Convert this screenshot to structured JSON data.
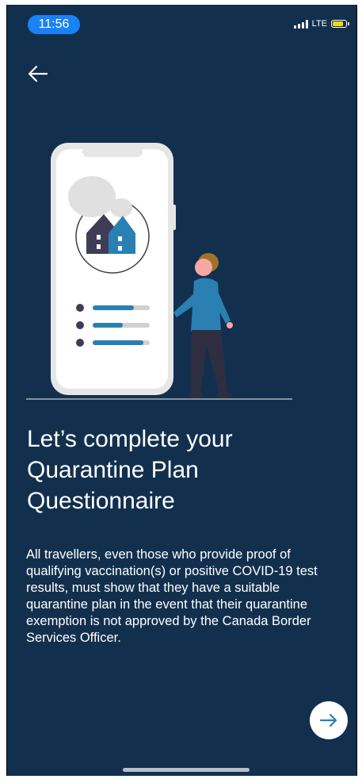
{
  "status_bar": {
    "time": "11:56",
    "network": "LTE",
    "signal_icon": "signal-bars-icon",
    "battery_icon": "battery-charging-icon"
  },
  "nav": {
    "back_icon": "arrow-left-icon"
  },
  "illustration": {
    "description_icon": "phone-house-checklist-person-illustration"
  },
  "content": {
    "heading": "Let’s complete your Quarantine Plan Questionnaire",
    "body": "All travellers, even those who provide proof of qualifying vaccination(s) or positive COVID-19 test results, must show that they have a suitable quarantine plan in the event that their quarantine exemption is not approved by the Canada Border Services Officer."
  },
  "next_button": {
    "icon": "arrow-right-icon"
  },
  "colors": {
    "background": "#12304e",
    "accent": "#2a7fb3",
    "status_pill": "#1a82f7",
    "battery": "#f5d60a"
  }
}
